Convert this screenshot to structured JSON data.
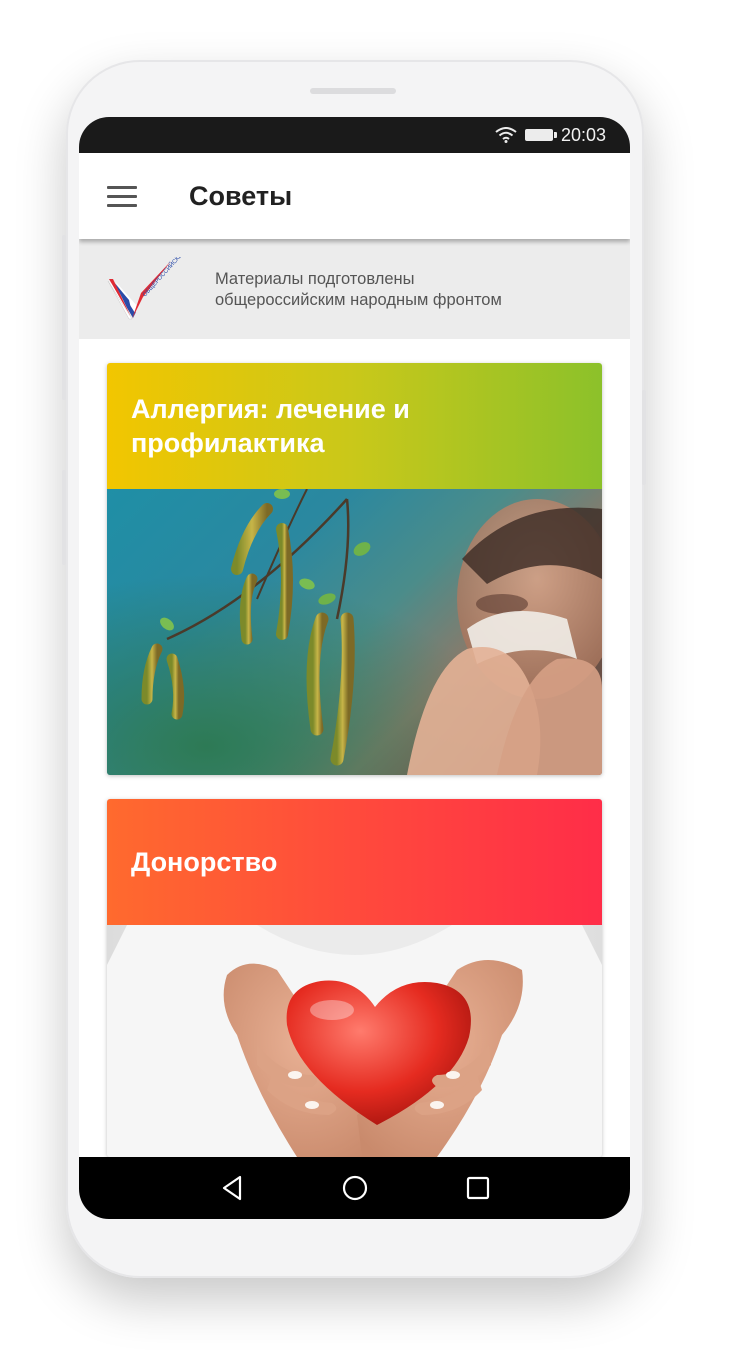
{
  "status_bar": {
    "time": "20:03",
    "icons": [
      "wifi-icon",
      "battery-icon"
    ]
  },
  "app_bar": {
    "menu_icon": "menu-icon",
    "title": "Советы"
  },
  "banner": {
    "logo": "onf-logo",
    "logo_text": "ОБЩЕРОССИЙСКИЙ НАРОДНЫЙ ФРОНТ",
    "text_line1": "Материалы подготовлены",
    "text_line2": "общероссийским народным фронтом"
  },
  "cards": [
    {
      "title": "Аллергия: лечение и профилактика",
      "image": "birch-catkins-sneezing-photo",
      "gradient": [
        "#f2c600",
        "#8cc12a"
      ]
    },
    {
      "title": "Донорство",
      "image": "hands-holding-heart-photo",
      "gradient": [
        "#ff6a2e",
        "#ff2d48"
      ]
    }
  ],
  "nav_bar": {
    "buttons": [
      "back-icon",
      "home-icon",
      "recents-icon"
    ]
  },
  "colors": {
    "status_bar": "#1a1a1a",
    "app_bar": "#ffffff",
    "banner": "#ececec",
    "nav_bar": "#000000"
  }
}
